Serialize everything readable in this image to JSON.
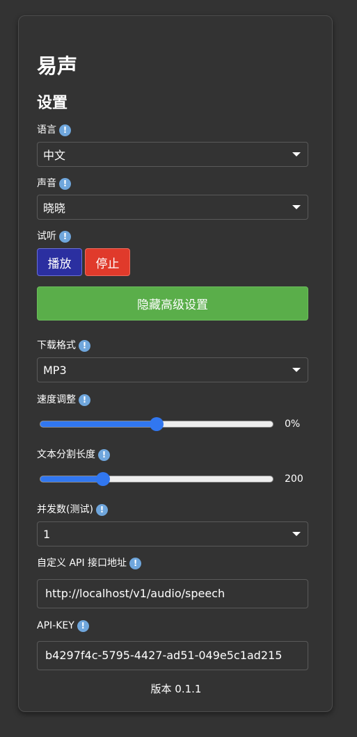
{
  "app": {
    "title": "易声"
  },
  "settings": {
    "heading": "设置",
    "language": {
      "label": "语言",
      "value": "中文",
      "icon": "info-icon"
    },
    "voice": {
      "label": "声音",
      "value": "晓晓",
      "icon": "info-icon"
    },
    "preview": {
      "label": "试听",
      "play_label": "播放",
      "stop_label": "停止"
    },
    "advanced_toggle_label": "隐藏高级设置",
    "download_format": {
      "label": "下载格式",
      "value": "MP3"
    },
    "speed": {
      "label": "速度调整",
      "value_text": "0%",
      "level": 0.5
    },
    "text_split": {
      "label": "文本分割长度",
      "value_text": "200",
      "level": 0.27
    },
    "concurrency": {
      "label": "并发数(测试)",
      "value": "1"
    },
    "api_url": {
      "label": "自定义 API 接口地址",
      "value": "http://localhost/v1/audio/speech"
    },
    "api_key": {
      "label": "API-KEY",
      "value": "b4297f4c-5795-4427-ad51-049e5c1ad215"
    }
  },
  "footer": {
    "version": "版本 0.1.1"
  },
  "colors": {
    "background": "#333333",
    "play_button": "#2b2fa0",
    "stop_button": "#e03a2b",
    "advanced_button": "#5aae4a",
    "slider_accent": "#3177f0",
    "info_icon": "#6fa6dc"
  }
}
